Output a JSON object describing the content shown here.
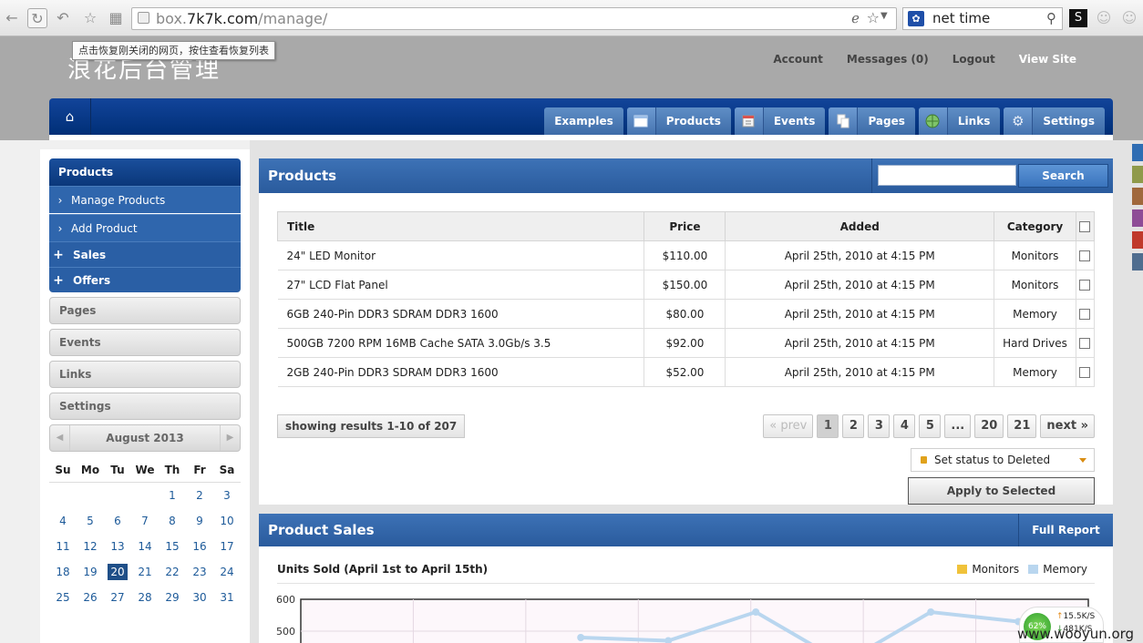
{
  "browser": {
    "url_prefix": "box.",
    "url_domain": "7k7k.com",
    "url_path": "/manage/",
    "search_value": "net time",
    "tooltip": "点击恢复刚关闭的网页，按住查看恢复列表"
  },
  "header": {
    "site_title": "浪花后台管理",
    "top_links": [
      "Account",
      "Messages (0)",
      "Logout",
      "View Site"
    ]
  },
  "nav": {
    "tabs": [
      {
        "label": "Examples",
        "icon": ""
      },
      {
        "label": "Products",
        "icon": "window-icon"
      },
      {
        "label": "Events",
        "icon": "calendar-icon"
      },
      {
        "label": "Pages",
        "icon": "pages-icon"
      },
      {
        "label": "Links",
        "icon": "globe-icon"
      },
      {
        "label": "Settings",
        "icon": "gear-icon"
      }
    ]
  },
  "sidebar": {
    "section_title": "Products",
    "items": [
      "Manage Products",
      "Add Product"
    ],
    "expandables": [
      "Sales",
      "Offers"
    ],
    "groups": [
      "Pages",
      "Events",
      "Links",
      "Settings"
    ]
  },
  "calendar": {
    "month": "August 2013",
    "weekdays": [
      "Su",
      "Mo",
      "Tu",
      "We",
      "Th",
      "Fr",
      "Sa"
    ],
    "weeks": [
      [
        "",
        "",
        "",
        "",
        "1",
        "2",
        "3"
      ],
      [
        "4",
        "5",
        "6",
        "7",
        "8",
        "9",
        "10"
      ],
      [
        "11",
        "12",
        "13",
        "14",
        "15",
        "16",
        "17"
      ],
      [
        "18",
        "19",
        "20",
        "21",
        "22",
        "23",
        "24"
      ],
      [
        "25",
        "26",
        "27",
        "28",
        "29",
        "30",
        "31"
      ]
    ],
    "today": "20"
  },
  "products_panel": {
    "title": "Products",
    "search_placeholder": "",
    "search_button": "Search",
    "columns": [
      "Title",
      "Price",
      "Added",
      "Category"
    ],
    "rows": [
      {
        "title": "24\" LED Monitor",
        "price": "$110.00",
        "added": "April 25th, 2010 at 4:15 PM",
        "category": "Monitors"
      },
      {
        "title": "27\" LCD Flat Panel",
        "price": "$150.00",
        "added": "April 25th, 2010 at 4:15 PM",
        "category": "Monitors"
      },
      {
        "title": "6GB 240-Pin DDR3 SDRAM DDR3 1600",
        "price": "$80.00",
        "added": "April 25th, 2010 at 4:15 PM",
        "category": "Memory"
      },
      {
        "title": "500GB 7200 RPM 16MB Cache SATA 3.0Gb/s 3.5",
        "price": "$92.00",
        "added": "April 25th, 2010 at 4:15 PM",
        "category": "Hard Drives"
      },
      {
        "title": "2GB 240-Pin DDR3 SDRAM DDR3 1600",
        "price": "$52.00",
        "added": "April 25th, 2010 at 4:15 PM",
        "category": "Memory"
      }
    ],
    "results_text": "showing results 1-10 of 207",
    "pager": [
      "« prev",
      "1",
      "2",
      "3",
      "4",
      "5",
      "...",
      "20",
      "21",
      "next »"
    ],
    "current_page": "1",
    "status_select": "Set status to Deleted",
    "apply_button": "Apply to Selected"
  },
  "sales_panel": {
    "title": "Product Sales",
    "full_report": "Full Report",
    "chart_title": "Units Sold (April 1st to April 15th)",
    "legend": [
      {
        "name": "Monitors",
        "color": "#f0c23a"
      },
      {
        "name": "Memory",
        "color": "#b9d6ef"
      }
    ],
    "y_ticks": [
      "600",
      "500"
    ]
  },
  "chart_data": {
    "type": "line",
    "title": "Units Sold (April 1st to April 15th)",
    "ylim": [
      0,
      600
    ],
    "y_ticks": [
      600,
      500
    ],
    "series": [
      {
        "name": "Memory",
        "color": "#b9d6ef",
        "values": [
          null,
          null,
          null,
          480,
          470,
          560,
          400,
          560,
          530,
          null
        ]
      }
    ]
  },
  "system": {
    "speed_percent": "62%",
    "upload": "15.5K/S",
    "download": "481K/S",
    "watermark": "www.wooyun.org",
    "strip_colors": [
      "#2f6db3",
      "#8f9a4a",
      "#a0683c",
      "#8e4c96",
      "#c0392b",
      "#4f6d8f"
    ]
  }
}
